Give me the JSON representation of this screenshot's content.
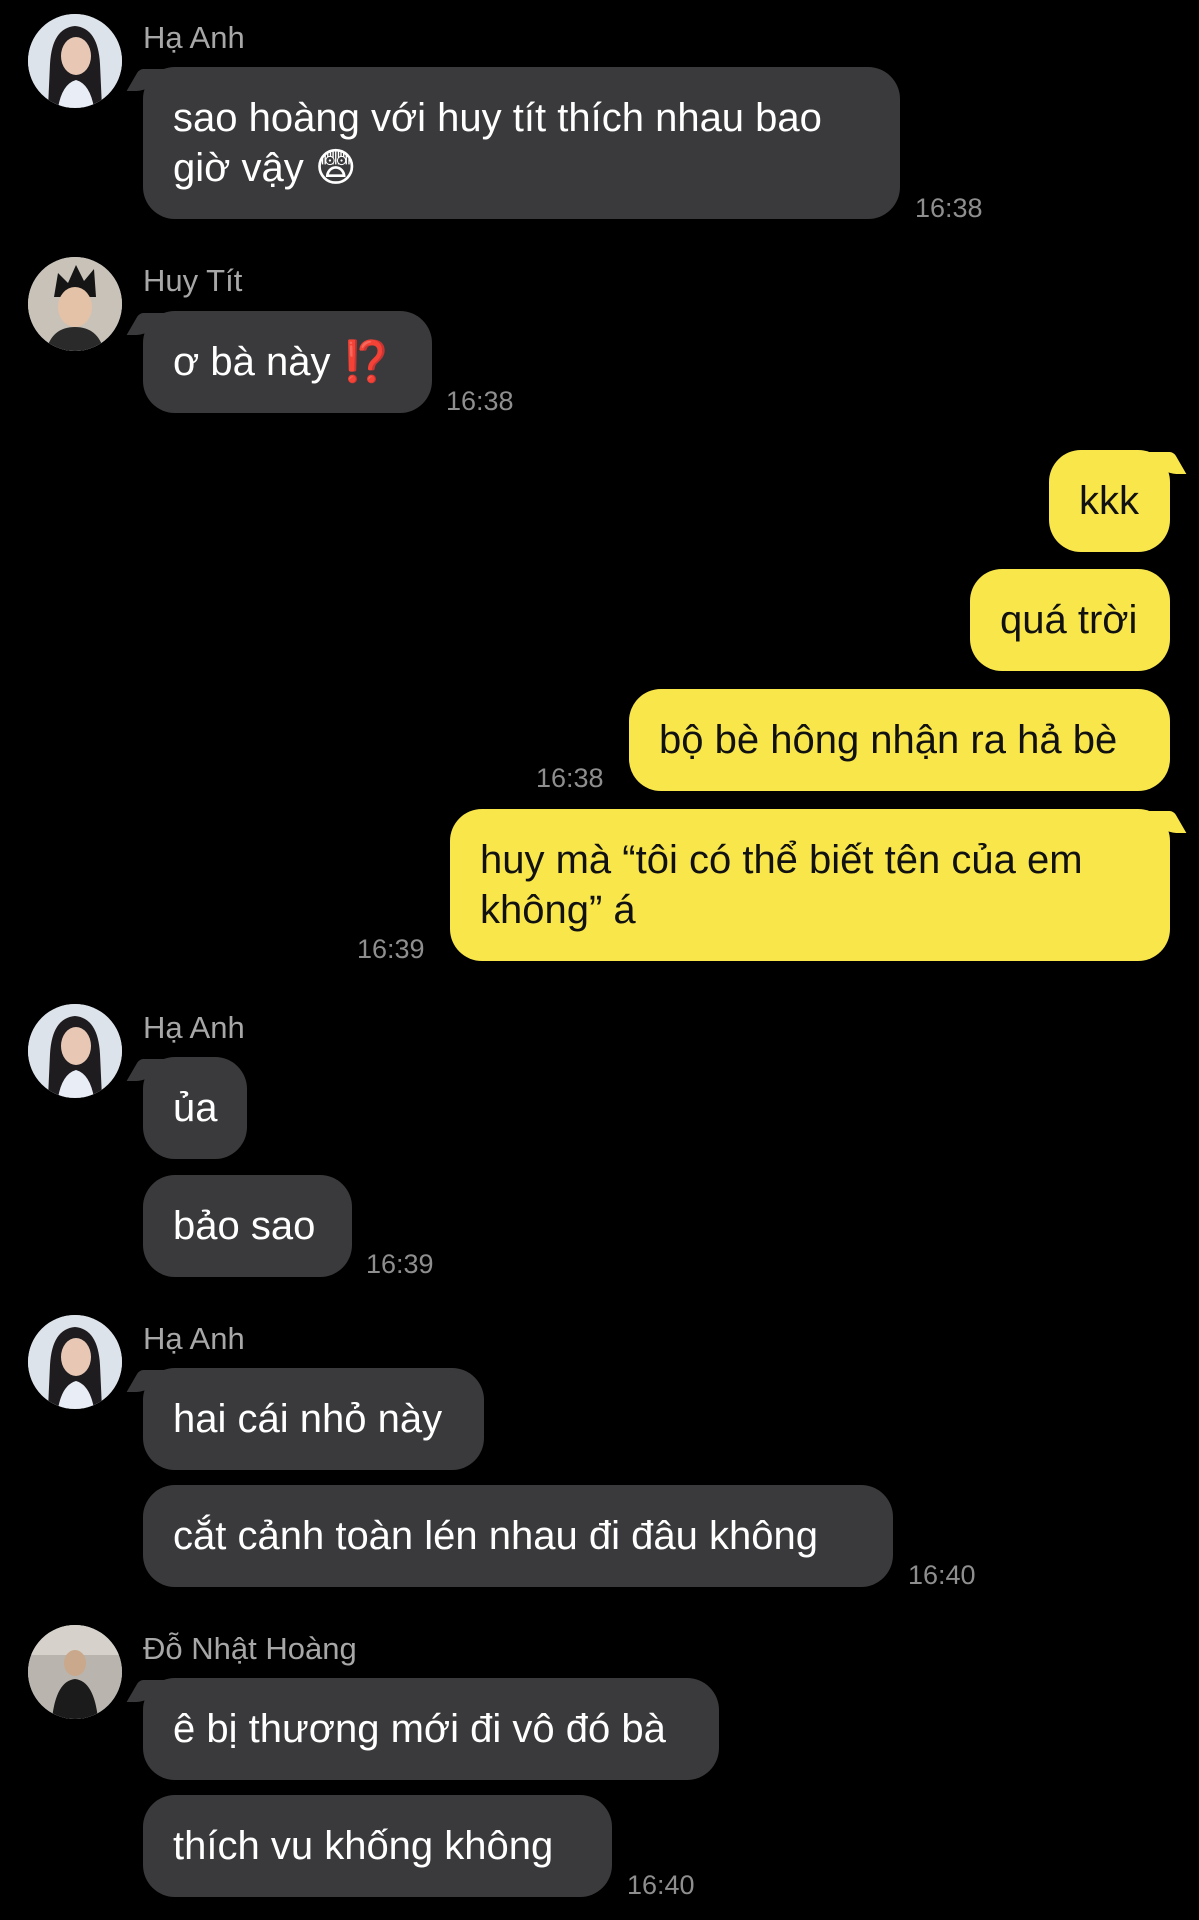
{
  "colors": {
    "background": "#000000",
    "incoming_bubble": "#3a3a3c",
    "outgoing_bubble": "#f8e64b",
    "timestamp": "#8e8e8e",
    "sender_name": "#a7a7a7"
  },
  "messages": [
    {
      "sender": "Hạ Anh",
      "text_line1": "sao hoàng với huy tít thích nhau bao",
      "text_line2": "giờ vậy",
      "emoji": "😨",
      "time": "16:38"
    },
    {
      "sender": "Huy Tít",
      "text": "ơ bà này",
      "emoji": "⁉️",
      "time": "16:38"
    },
    {
      "text": "kkk"
    },
    {
      "text": "quá trời"
    },
    {
      "text": "bộ bè hông nhận ra hả bè",
      "time": "16:38"
    },
    {
      "text_line1": "huy mà “tôi có thể biết tên của em",
      "text_line2": "không” á",
      "time": "16:39"
    },
    {
      "sender": "Hạ Anh",
      "text": "ủa"
    },
    {
      "text": "bảo sao",
      "time": "16:39"
    },
    {
      "sender": "Hạ Anh",
      "text": "hai cái nhỏ này"
    },
    {
      "text": "cắt cảnh toàn lén nhau đi đâu không",
      "time": "16:40"
    },
    {
      "sender": "Đỗ Nhật Hoàng",
      "text": "ê bị thương mới đi vô đó bà"
    },
    {
      "text": "thích vu khống không",
      "time": "16:40"
    }
  ]
}
